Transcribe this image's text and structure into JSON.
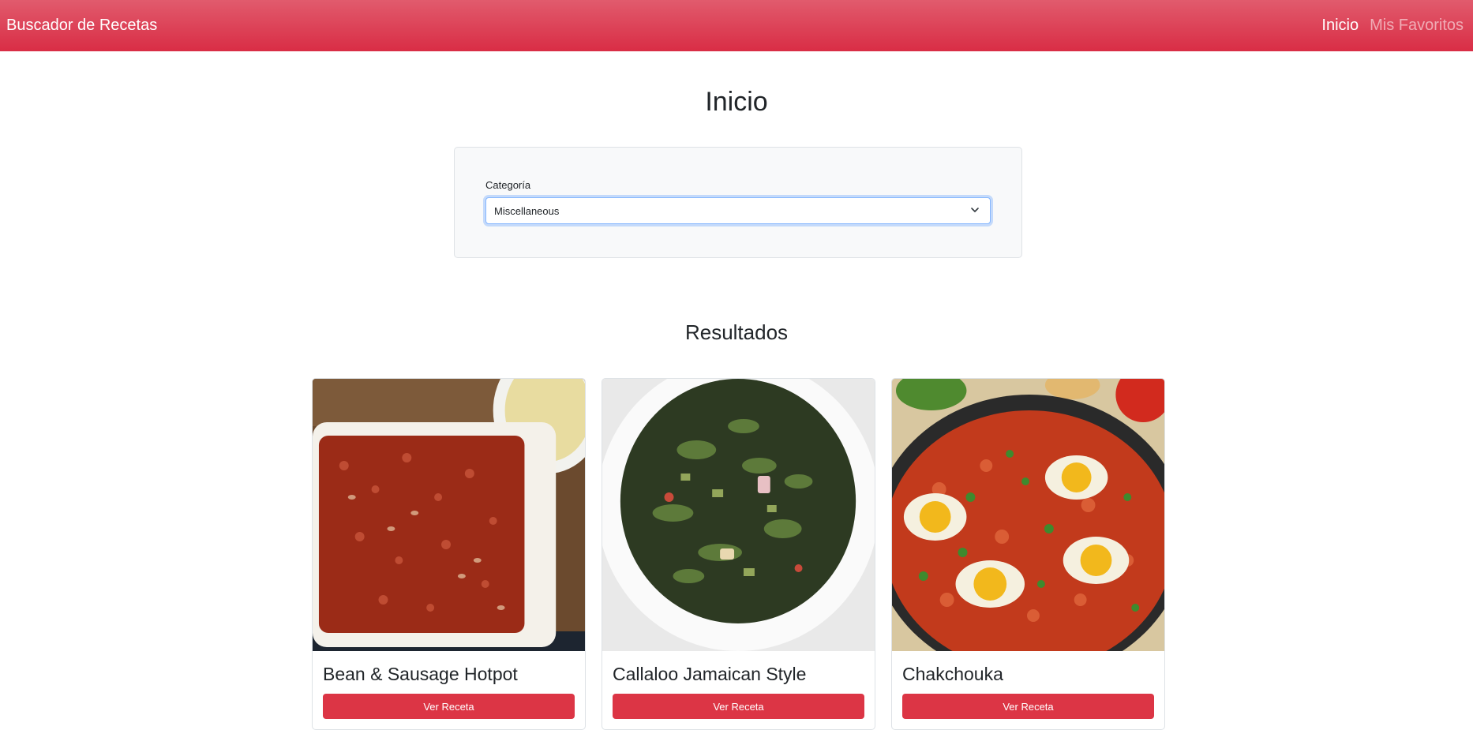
{
  "navbar": {
    "brand": "Buscador de Recetas",
    "links": [
      {
        "label": "Inicio",
        "active": true
      },
      {
        "label": "Mis Favoritos",
        "active": false
      }
    ],
    "color": "#dc3545"
  },
  "main": {
    "title": "Inicio",
    "filter": {
      "label": "Categoría",
      "selected": "Miscellaneous"
    },
    "results_title": "Resultados",
    "recipes": [
      {
        "name": "Bean & Sausage Hotpot",
        "button": "Ver Receta",
        "image": "baked-beans-dish-photo"
      },
      {
        "name": "Callaloo Jamaican Style",
        "button": "Ver Receta",
        "image": "callaloo-greens-bowl-photo"
      },
      {
        "name": "Chakchouka",
        "button": "Ver Receta",
        "image": "shakshuka-pan-eggs-photo"
      }
    ]
  },
  "icons": {
    "select_arrow": "chevron-down-icon"
  }
}
